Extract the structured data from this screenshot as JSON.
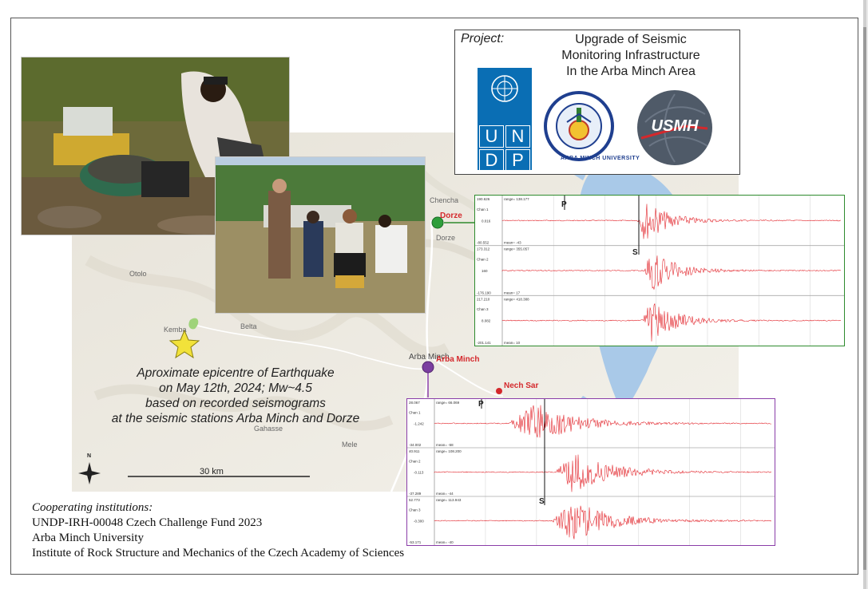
{
  "project": {
    "label": "Project:",
    "title_lines": [
      "Upgrade of Seismic",
      "Monitoring Infrastructure",
      "In the Arba Minch Area"
    ]
  },
  "logos": {
    "undp_letters": [
      "U",
      "N",
      "D",
      "P"
    ],
    "university_text": "ARBA MINCH UNIVERSITY",
    "usmh_text": "USMH"
  },
  "map": {
    "places": {
      "chencha": "Chencha",
      "dorze": "Dorze",
      "dorze_small": "Dorze",
      "otolo": "Otolo",
      "kemba": "Kemba",
      "belta": "Belta",
      "arba_minch": "Arba Minch",
      "arba_minch_station": "Arba Minch",
      "nech_sar": "Nech Sar",
      "mele": "Mele",
      "gahasse": "Gahasse"
    },
    "scale_label": "30 km",
    "north_label": "N",
    "colors": {
      "dorze_station": "#2e9e3b",
      "arba_minch_station": "#7b3fa0",
      "nech_sar": "#d4282c",
      "epicentre_star": "#f2e23a"
    }
  },
  "caption": {
    "lines": [
      "Aproximate epicentre of Earthquake",
      "on May 12th, 2024; Mw~4.5",
      "based on recorded seismograms",
      "at the seismic stations Arba Minch and Dorze"
    ]
  },
  "seismograms": {
    "dorze": {
      "border_color": "#2e8b2e",
      "phase_p": "P",
      "phase_s": "S",
      "channels": [
        {
          "name": "Chan 1",
          "top": "190.626",
          "range": "range= 138.177",
          "mid": "0.016",
          "bottom": "-80.552",
          "mean": "mean= -43"
        },
        {
          "name": "Chan 2",
          "top": "173.312",
          "range": "range= 355.057",
          "mid": "160",
          "bottom": "-176.190",
          "mean": "mean= 17"
        },
        {
          "name": "Chan 3",
          "top": "217.210",
          "range": "range= 418.388",
          "mid": "8.082",
          "bottom": "-201.141",
          "mean": "mean= 10"
        }
      ]
    },
    "arba_minch": {
      "border_color": "#8a3da8",
      "phase_p": "P",
      "phase_s": "S",
      "channels": [
        {
          "name": "Chan 1",
          "top": "28.067",
          "range": "range= 66.069",
          "mid": "-1.242",
          "bottom": "-34.002",
          "mean": "mean= -58"
        },
        {
          "name": "Chan 2",
          "top": "40.911",
          "range": "range= 108.200",
          "mid": "-0.113",
          "bottom": "-37.289",
          "mean": "mean= -44"
        },
        {
          "name": "Chan 3",
          "top": "52.773",
          "range": "range= 113.943",
          "mid": "-0.300",
          "bottom": "-53.171",
          "mean": "mean= -40"
        }
      ]
    }
  },
  "cooperating": {
    "heading": "Cooperating institutions:",
    "lines": [
      "UNDP-IRH-00048 Czech Challenge Fund 2023",
      "Arba Minch University",
      "Institute of Rock Structure and Mechanics of the Czech Academy of Sciences"
    ]
  }
}
